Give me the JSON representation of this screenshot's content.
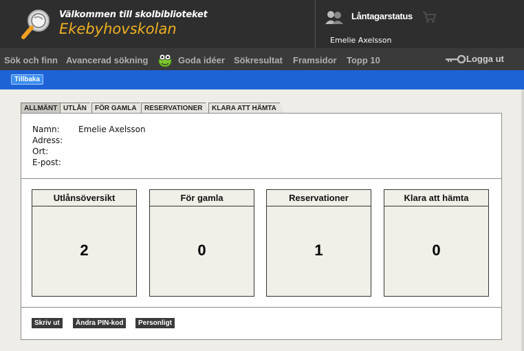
{
  "header": {
    "welcome": "Välkommen till skolbiblioteket",
    "school": "Ekebyhovskolan",
    "status_label": "Låntagarstatus",
    "user_name": "Emelie Axelsson"
  },
  "nav": {
    "items": [
      "Sök och finn",
      "Avancerad sökning",
      "Goda idéer",
      "Sökresultat",
      "Framsidor",
      "Topp 10"
    ],
    "logout": "Logga ut"
  },
  "toolbar": {
    "back_label": "Tillbaka"
  },
  "tabs": [
    "ALLMÄNT",
    "UTLÅN",
    "FÖR GAMLA",
    "RESERVATIONER",
    "KLARA ATT HÄMTA"
  ],
  "info": {
    "name_label": "Namn:",
    "name_value": "Emelie Axelsson",
    "address_label": "Adress:",
    "city_label": "Ort:",
    "email_label": "E-post:"
  },
  "summary": [
    {
      "title": "Utlånsöversikt",
      "value": "2"
    },
    {
      "title": "För gamla",
      "value": "0"
    },
    {
      "title": "Reservationer",
      "value": "1"
    },
    {
      "title": "Klara att hämta",
      "value": "0"
    }
  ],
  "actions": {
    "print": "Skriv ut",
    "change_pin": "Ändra PIN-kod",
    "personal": "Personligt"
  },
  "icons": {
    "logo": "magnifier-globe-icon",
    "users": "users-icon",
    "cart": "cart-icon",
    "bug": "bug-mascot-icon",
    "key": "key-icon"
  },
  "colors": {
    "header_bg": "#2e2e2e",
    "accent_orange": "#f0b020",
    "bluebar": "#1e63d6"
  }
}
